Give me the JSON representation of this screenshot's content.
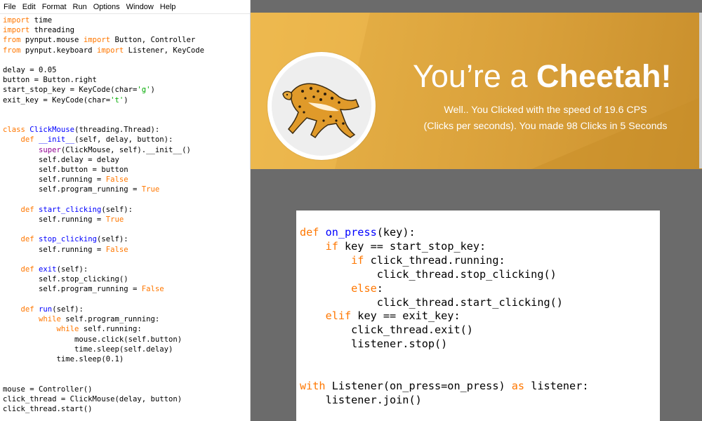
{
  "menu": [
    "File",
    "Edit",
    "Format",
    "Run",
    "Options",
    "Window",
    "Help"
  ],
  "left_code": [
    [
      [
        "kw",
        "import"
      ],
      [
        "t",
        " time"
      ]
    ],
    [
      [
        "kw",
        "import"
      ],
      [
        "t",
        " threading"
      ]
    ],
    [
      [
        "kw",
        "from"
      ],
      [
        "t",
        " pynput.mouse "
      ],
      [
        "kw",
        "import"
      ],
      [
        "t",
        " Button, Controller"
      ]
    ],
    [
      [
        "kw",
        "from"
      ],
      [
        "t",
        " pynput.keyboard "
      ],
      [
        "kw",
        "import"
      ],
      [
        "t",
        " Listener, KeyCode"
      ]
    ],
    [],
    [
      [
        "t",
        "delay = 0.05"
      ]
    ],
    [
      [
        "t",
        "button = Button.right"
      ]
    ],
    [
      [
        "t",
        "start_stop_key = KeyCode(char="
      ],
      [
        "str",
        "'g'"
      ],
      [
        "t",
        ")"
      ]
    ],
    [
      [
        "t",
        "exit_key = KeyCode(char="
      ],
      [
        "str",
        "'t'"
      ],
      [
        "t",
        ")"
      ]
    ],
    [],
    [],
    [
      [
        "kw",
        "class"
      ],
      [
        "t",
        " "
      ],
      [
        "df",
        "ClickMouse"
      ],
      [
        "t",
        "(threading.Thread):"
      ]
    ],
    [
      [
        "t",
        "    "
      ],
      [
        "kw",
        "def"
      ],
      [
        "t",
        " "
      ],
      [
        "df",
        "__init__"
      ],
      [
        "t",
        "(self, delay, button):"
      ]
    ],
    [
      [
        "t",
        "        "
      ],
      [
        "bi",
        "super"
      ],
      [
        "t",
        "(ClickMouse, self).__init__()"
      ]
    ],
    [
      [
        "t",
        "        self.delay = delay"
      ]
    ],
    [
      [
        "t",
        "        self.button = button"
      ]
    ],
    [
      [
        "t",
        "        self.running = "
      ],
      [
        "kw",
        "False"
      ]
    ],
    [
      [
        "t",
        "        self.program_running = "
      ],
      [
        "kw",
        "True"
      ]
    ],
    [],
    [
      [
        "t",
        "    "
      ],
      [
        "kw",
        "def"
      ],
      [
        "t",
        " "
      ],
      [
        "df",
        "start_clicking"
      ],
      [
        "t",
        "(self):"
      ]
    ],
    [
      [
        "t",
        "        self.running = "
      ],
      [
        "kw",
        "True"
      ]
    ],
    [],
    [
      [
        "t",
        "    "
      ],
      [
        "kw",
        "def"
      ],
      [
        "t",
        " "
      ],
      [
        "df",
        "stop_clicking"
      ],
      [
        "t",
        "(self):"
      ]
    ],
    [
      [
        "t",
        "        self.running = "
      ],
      [
        "kw",
        "False"
      ]
    ],
    [],
    [
      [
        "t",
        "    "
      ],
      [
        "kw",
        "def"
      ],
      [
        "t",
        " "
      ],
      [
        "df",
        "exit"
      ],
      [
        "t",
        "(self):"
      ]
    ],
    [
      [
        "t",
        "        self.stop_clicking()"
      ]
    ],
    [
      [
        "t",
        "        self.program_running = "
      ],
      [
        "kw",
        "False"
      ]
    ],
    [],
    [
      [
        "t",
        "    "
      ],
      [
        "kw",
        "def"
      ],
      [
        "t",
        " "
      ],
      [
        "df",
        "run"
      ],
      [
        "t",
        "(self):"
      ]
    ],
    [
      [
        "t",
        "        "
      ],
      [
        "kw",
        "while"
      ],
      [
        "t",
        " self.program_running:"
      ]
    ],
    [
      [
        "t",
        "            "
      ],
      [
        "kw",
        "while"
      ],
      [
        "t",
        " self.running:"
      ]
    ],
    [
      [
        "t",
        "                mouse.click(self.button)"
      ]
    ],
    [
      [
        "t",
        "                time.sleep(self.delay)"
      ]
    ],
    [
      [
        "t",
        "            time.sleep(0.1)"
      ]
    ],
    [],
    [],
    [
      [
        "t",
        "mouse = Controller()"
      ]
    ],
    [
      [
        "t",
        "click_thread = ClickMouse(delay, button)"
      ]
    ],
    [
      [
        "t",
        "click_thread.start()"
      ]
    ]
  ],
  "banner": {
    "title_plain": "You’re a ",
    "title_bold": "Cheetah!",
    "line1_plain": "Well.. You Clicked with the speed of ",
    "line1_bold": "19.6 CPS",
    "line2_plain": "(Clicks per seconds). You made ",
    "line2_bold": "98 Clicks in 5 Seconds",
    "colors": {
      "gold": "#e2aa42",
      "text": "#ffffff"
    },
    "image_icon": "cheetah-icon"
  },
  "right_code": [
    [
      [
        "kw",
        "def"
      ],
      [
        "t",
        " "
      ],
      [
        "df",
        "on_press"
      ],
      [
        "t",
        "(key):"
      ]
    ],
    [
      [
        "t",
        "    "
      ],
      [
        "kw",
        "if"
      ],
      [
        "t",
        " key == start_stop_key:"
      ]
    ],
    [
      [
        "t",
        "        "
      ],
      [
        "kw",
        "if"
      ],
      [
        "t",
        " click_thread.running:"
      ]
    ],
    [
      [
        "t",
        "            click_thread.stop_clicking()"
      ]
    ],
    [
      [
        "t",
        "        "
      ],
      [
        "kw",
        "else"
      ],
      [
        "t",
        ":"
      ]
    ],
    [
      [
        "t",
        "            click_thread.start_clicking()"
      ]
    ],
    [
      [
        "t",
        "    "
      ],
      [
        "kw",
        "elif"
      ],
      [
        "t",
        " key == exit_key:"
      ]
    ],
    [
      [
        "t",
        "        click_thread.exit()"
      ]
    ],
    [
      [
        "t",
        "        listener.stop()"
      ]
    ],
    [],
    [],
    [
      [
        "kw",
        "with"
      ],
      [
        "t",
        " Listener(on_press=on_press) "
      ],
      [
        "kw",
        "as"
      ],
      [
        "t",
        " listener:"
      ]
    ],
    [
      [
        "t",
        "    listener.join()"
      ]
    ]
  ],
  "syntax_colors": {
    "keyword": "#ff7700",
    "builtin": "#900090",
    "definition": "#0000ff",
    "string": "#00aa00"
  }
}
